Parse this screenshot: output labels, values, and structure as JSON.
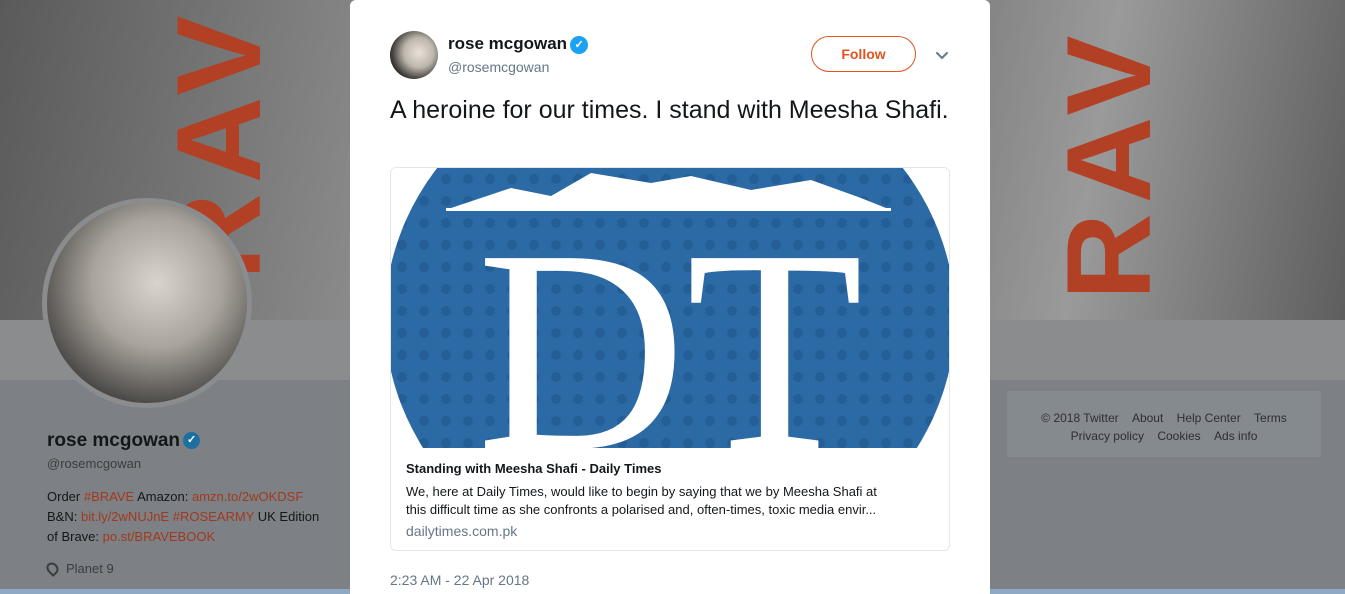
{
  "profile_background": {
    "name": "rose mcgowan",
    "handle": "@rosemcgowan",
    "bio": {
      "line1_prefix": "Order ",
      "line1_tag": "#BRAVE",
      "line1_mid": " Amazon: ",
      "line1_link": "amzn.to/2wOKDSF",
      "line2_prefix": "B&N: ",
      "line2_link": "bit.ly/2wNUJnE",
      "line2_tag": "#ROSEARMY",
      "line2_suffix": " UK Edition",
      "line3_prefix": "of Brave: ",
      "line3_link": "po.st/BRAVEBOOK"
    },
    "location": "Planet 9"
  },
  "footer": {
    "copyright": "© 2018 Twitter",
    "about": "About",
    "help": "Help Center",
    "terms": "Terms",
    "privacy": "Privacy policy",
    "cookies": "Cookies",
    "ads": "Ads info"
  },
  "tweet": {
    "author_name": "rose mcgowan",
    "author_handle": "@rosemcgowan",
    "follow_label": "Follow",
    "text": "A heroine for our times. I stand with Meesha Shafi.",
    "card": {
      "logo_text": "DT",
      "title": "Standing with Meesha Shafi - Daily Times",
      "desc_line1": "We, here at Daily Times, would like to begin by saying that we by Meesha Shafi at",
      "desc_line2": "this difficult time as she confronts a polarised and, often-times, toxic media envir...",
      "domain": "dailytimes.com.pk"
    },
    "timestamp": "2:23 AM - 22 Apr 2018"
  },
  "colors": {
    "accent": "#e0531f",
    "verified": "#1da1f2",
    "card_blue": "#2c6aa6"
  }
}
